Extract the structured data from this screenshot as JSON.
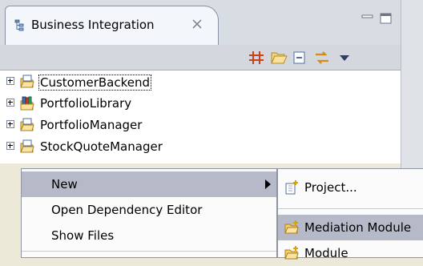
{
  "view": {
    "title": "Business Integration",
    "icons": {
      "view": "view-tree-icon",
      "close": "close-icon",
      "minimize": "minimize-icon",
      "maximize": "maximize-icon"
    }
  },
  "toolbar": {
    "buttons": [
      {
        "name": "link-with-editor-icon"
      },
      {
        "name": "open-folder-icon"
      },
      {
        "name": "collapse-all-icon"
      },
      {
        "name": "sync-icon"
      },
      {
        "name": "view-menu-icon"
      }
    ]
  },
  "tree": {
    "items": [
      {
        "label": "CustomerBackend",
        "icon": "module-icon",
        "selected": true
      },
      {
        "label": "PortfolioLibrary",
        "icon": "library-icon",
        "selected": false
      },
      {
        "label": "PortfolioManager",
        "icon": "module-icon",
        "selected": false
      },
      {
        "label": "StockQuoteManager",
        "icon": "module-icon",
        "selected": false
      }
    ]
  },
  "context_menu": {
    "items": [
      {
        "label": "New",
        "highlighted": true,
        "submenu": true
      },
      {
        "label": "Open Dependency Editor"
      },
      {
        "label": "Show Files"
      }
    ]
  },
  "submenu": {
    "items": [
      {
        "label": "Project...",
        "icon": "new-project-icon"
      },
      {
        "label": "Mediation Module",
        "icon": "mediation-module-icon",
        "highlighted": true
      },
      {
        "label": "Module",
        "icon": "module-icon"
      }
    ]
  },
  "colors": {
    "highlight": "#b5b9c8",
    "menu_bg": "#fbfbfb",
    "header_bg": "#d8dce3"
  }
}
